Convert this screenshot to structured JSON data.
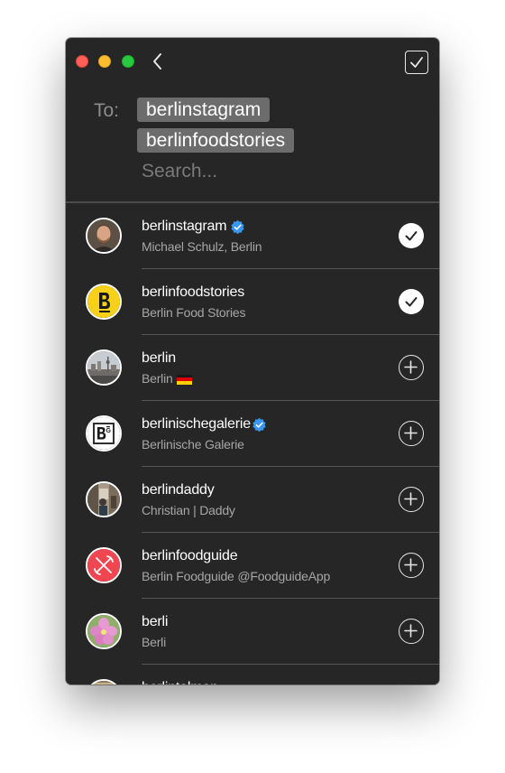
{
  "window": {
    "buttons": [
      "close",
      "minimize",
      "zoom"
    ],
    "back_icon": "chevron-left-icon",
    "done_icon": "checkbox-check-icon"
  },
  "compose": {
    "to_label": "To:",
    "recipients": [
      "berlinstagram",
      "berlinfoodstories"
    ],
    "search_placeholder": "Search...",
    "search_value": ""
  },
  "accounts": [
    {
      "username": "berlinstagram",
      "subtitle": "Michael Schulz, Berlin",
      "verified": true,
      "selected": true,
      "avatar": "portrait-man-photo"
    },
    {
      "username": "berlinfoodstories",
      "subtitle": "Berlin Food Stories",
      "verified": false,
      "selected": true,
      "avatar": "yellow-b-logo"
    },
    {
      "username": "berlin",
      "subtitle": "Berlin",
      "subtitle_flag": "germany-flag-icon",
      "verified": false,
      "selected": false,
      "avatar": "city-skyline-photo"
    },
    {
      "username": "berlinischegalerie",
      "subtitle": "Berlinische Galerie",
      "verified": true,
      "selected": false,
      "avatar": "bg-logo"
    },
    {
      "username": "berlindaddy",
      "subtitle": "Christian | Daddy",
      "verified": false,
      "selected": false,
      "avatar": "street-photo"
    },
    {
      "username": "berlinfoodguide",
      "subtitle": "Berlin Foodguide @FoodguideApp",
      "verified": false,
      "selected": false,
      "avatar": "fork-knife-logo"
    },
    {
      "username": "berli",
      "subtitle": "Berli",
      "verified": false,
      "selected": false,
      "avatar": "pink-flower-photo"
    },
    {
      "username": "berlintalmon",
      "subtitle": "",
      "verified": false,
      "selected": false,
      "avatar": "partial-photo"
    }
  ],
  "colors": {
    "window_bg": "#262626",
    "chip_bg": "#6c6c6c",
    "verified_blue": "#3897f0",
    "foodstories_yellow": "#f7d117",
    "foodguide_red": "#ef4652"
  }
}
